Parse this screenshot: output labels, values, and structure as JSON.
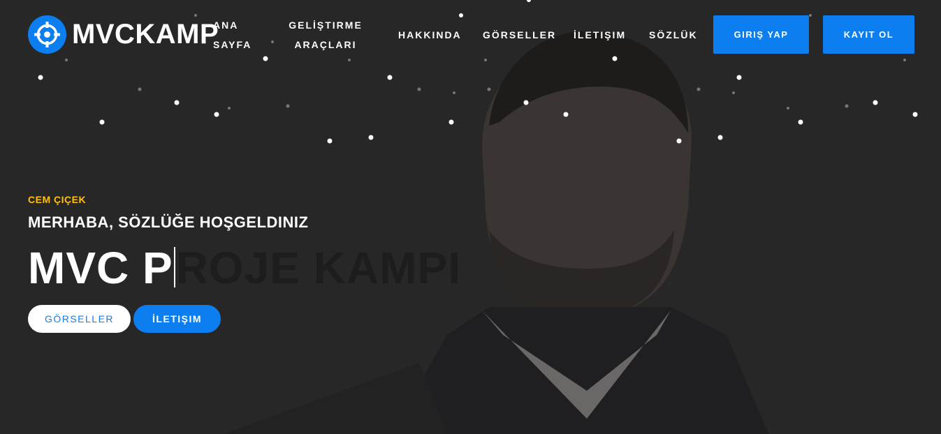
{
  "brand": {
    "name": "MVCKAMP",
    "accent": "#0d7ef0",
    "icon": "crosshair-icon"
  },
  "nav": {
    "home_line1": "ANA",
    "home_line2": "SAYFA",
    "dev_line1": "GELİŞTIRME",
    "dev_line2": "ARAÇLARI",
    "about": "HAKKINDA",
    "gallery": "GÖRSELLER",
    "contact": "İLETIŞIM",
    "dictionary": "SÖZLÜK"
  },
  "auth": {
    "login": "GIRIŞ YAP",
    "register": "KAYIT OL"
  },
  "hero": {
    "name": "CEM ÇIÇEK",
    "welcome": "MERHABA, SÖZLÜĞE HOŞGELDINIZ",
    "headline_typed": "MVC P",
    "headline_rest": "ROJE KAMPI",
    "btn_gallery": "GÖRSELLER",
    "btn_contact": "İLETIŞIM",
    "name_color": "#ffc107"
  }
}
